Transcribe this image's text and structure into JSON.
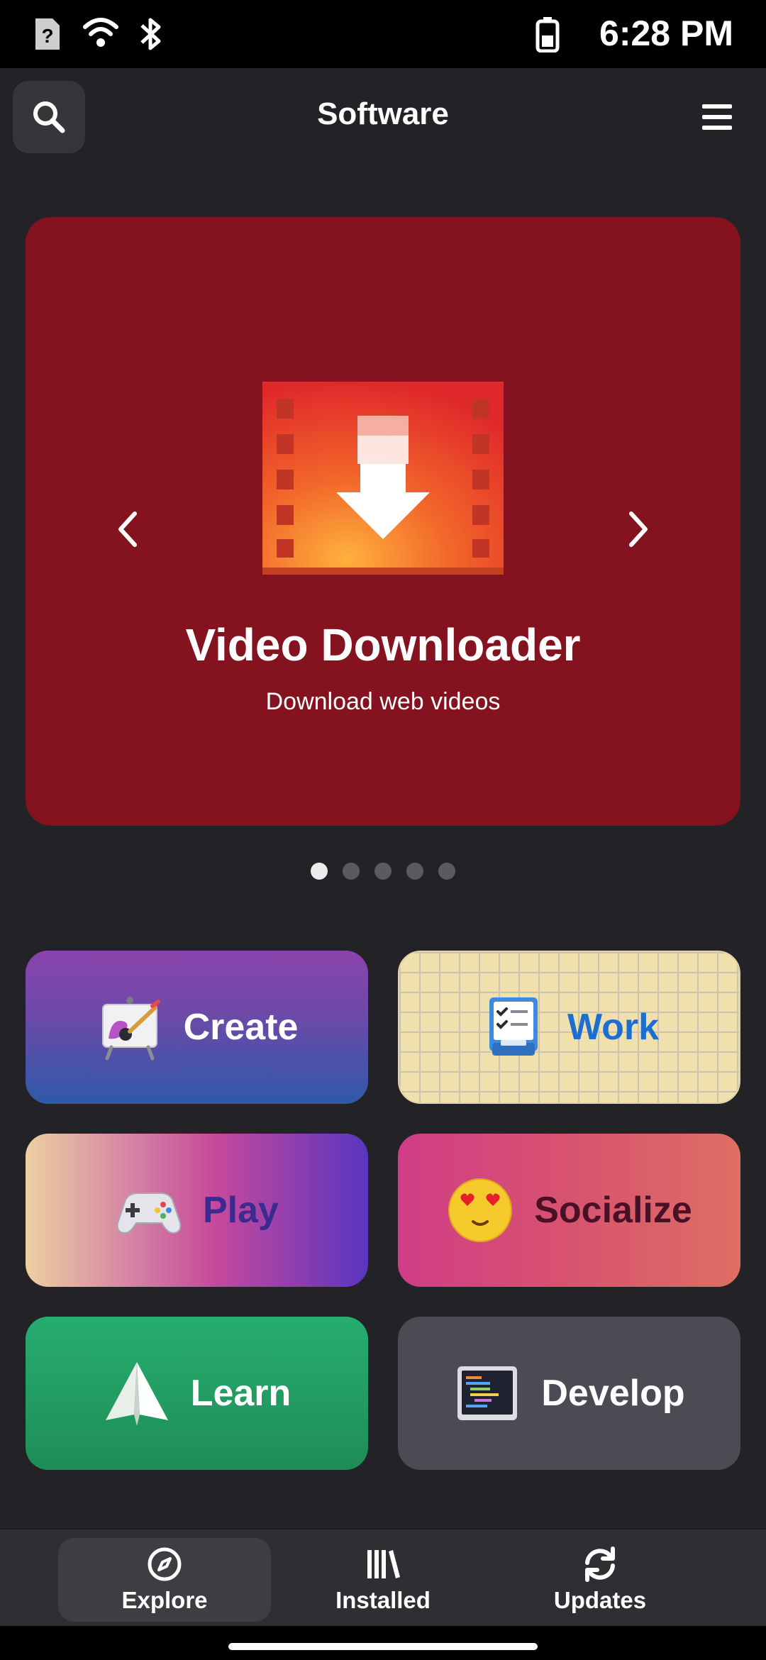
{
  "status_bar": {
    "time": "6:28 PM",
    "icons": [
      "sim-unknown-icon",
      "wifi-icon",
      "bluetooth-icon",
      "battery-icon"
    ]
  },
  "header": {
    "title": "Software",
    "left_icon": "search-icon",
    "right_icon": "hamburger-menu-icon"
  },
  "banner": {
    "title": "Video Downloader",
    "subtitle": "Download web videos",
    "background": "#84121f",
    "art_icon": "video-download-icon",
    "prev_icon": "chevron-left-icon",
    "next_icon": "chevron-right-icon"
  },
  "carousel": {
    "total": 5,
    "active_index": 0
  },
  "categories": [
    {
      "label": "Create",
      "icon": "easel-paint-icon",
      "text_color": "#ffffff"
    },
    {
      "label": "Work",
      "icon": "checklist-icon",
      "text_color": "#1c6fd1"
    },
    {
      "label": "Play",
      "icon": "gamepad-icon",
      "text_color": "#3b2a8f"
    },
    {
      "label": "Socialize",
      "icon": "heart-eyes-emoji-icon",
      "text_color": "#4a1026"
    },
    {
      "label": "Learn",
      "icon": "paper-plane-icon",
      "text_color": "#ffffff"
    },
    {
      "label": "Develop",
      "icon": "code-editor-icon",
      "text_color": "#ffffff"
    }
  ],
  "bottom_nav": {
    "items": [
      {
        "label": "Explore",
        "icon": "compass-icon",
        "active": true
      },
      {
        "label": "Installed",
        "icon": "library-icon",
        "active": false
      },
      {
        "label": "Updates",
        "icon": "refresh-icon",
        "active": false
      }
    ]
  }
}
